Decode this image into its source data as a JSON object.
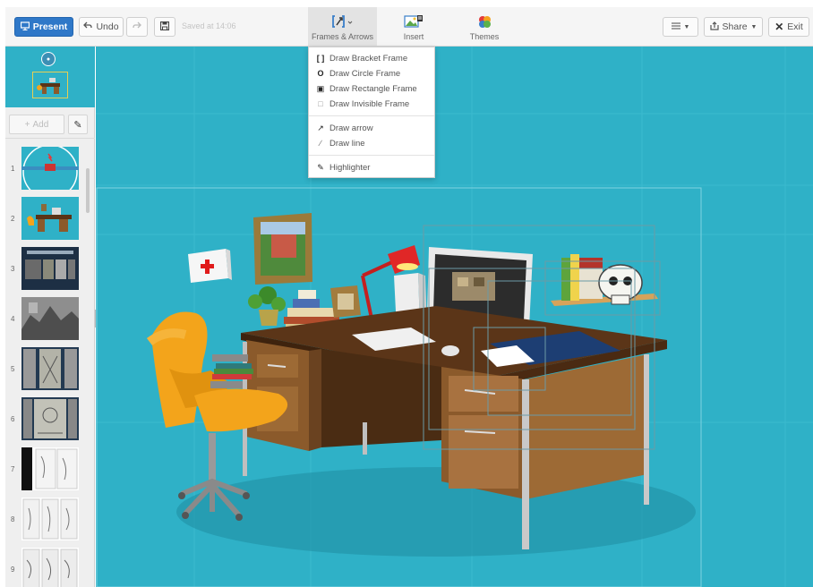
{
  "toolbar": {
    "present_label": "Present",
    "undo_label": "Undo",
    "saved_text": "Saved at 14:06",
    "tools": [
      {
        "label": "Frames & Arrows"
      },
      {
        "label": "Insert"
      },
      {
        "label": "Themes"
      }
    ],
    "share_label": "Share",
    "exit_label": "Exit"
  },
  "dropdown": {
    "items": [
      {
        "icon": "bracket-frame-icon",
        "label": "Draw Bracket Frame"
      },
      {
        "icon": "circle-frame-icon",
        "label": "Draw Circle Frame"
      },
      {
        "icon": "rectangle-frame-icon",
        "label": "Draw Rectangle Frame"
      },
      {
        "icon": "invisible-frame-icon",
        "label": "Draw Invisible Frame"
      },
      {
        "icon": "arrow-icon",
        "label": "Draw arrow"
      },
      {
        "icon": "line-icon",
        "label": "Draw line"
      },
      {
        "icon": "highlighter-icon",
        "label": "Highlighter"
      }
    ]
  },
  "sidebar": {
    "add_label": "Add",
    "slides": [
      {
        "number": "1"
      },
      {
        "number": "2"
      },
      {
        "number": "3"
      },
      {
        "number": "4"
      },
      {
        "number": "5"
      },
      {
        "number": "6"
      },
      {
        "number": "7"
      },
      {
        "number": "8"
      },
      {
        "number": "9"
      }
    ]
  },
  "colors": {
    "canvas_bg": "#2fb1c7",
    "present_button": "#2f78c8",
    "desk_wood": "#8b5a2b",
    "chair": "#f3a41b"
  }
}
